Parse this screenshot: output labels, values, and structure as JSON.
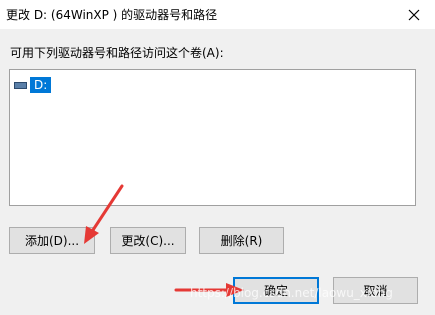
{
  "window": {
    "title": "更改 D: (64WinXP ) 的驱动器号和路径"
  },
  "dialog": {
    "prompt": "可用下列驱动器号和路径访问这个卷(A):",
    "list_items": [
      {
        "label": "D:",
        "icon": "drive-icon",
        "selected": true
      }
    ],
    "buttons": {
      "add": "添加(D)...",
      "change": "更改(C)...",
      "remove": "删除(R)",
      "ok": "确定",
      "cancel": "取消"
    }
  },
  "annotations": {
    "arrow_color": "#e53935"
  },
  "watermark": "https://blog.csdn.net/laowu_xiong",
  "colors": {
    "selection": "#0078d7",
    "default_button_border": "#0078d7",
    "button_face": "#e1e1e1"
  }
}
